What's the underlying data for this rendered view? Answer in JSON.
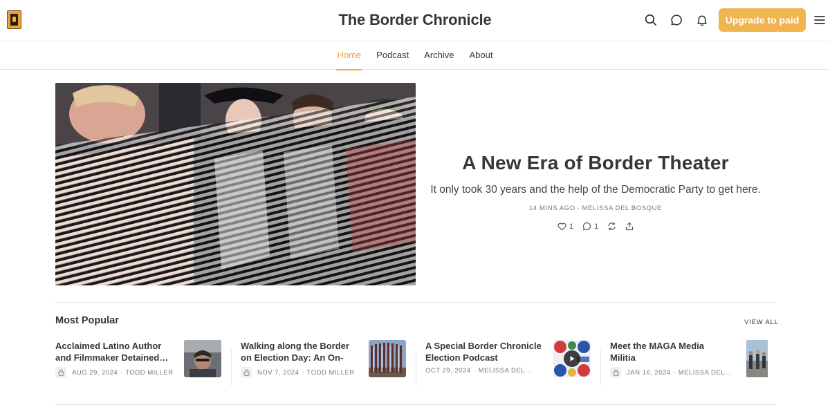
{
  "header": {
    "site_title": "The Border Chronicle",
    "upgrade_label": "Upgrade to paid",
    "icons": [
      "search-icon",
      "chat-icon",
      "bell-icon",
      "menu-icon"
    ],
    "accent_color": "#f0b54e"
  },
  "nav": {
    "items": [
      {
        "label": "Home",
        "active": true
      },
      {
        "label": "Podcast",
        "active": false
      },
      {
        "label": "Archive",
        "active": false
      },
      {
        "label": "About",
        "active": false
      }
    ]
  },
  "hero": {
    "title": "A New Era of Border Theater",
    "subtitle": "It only took 30 years and the help of the Democratic Party to get here.",
    "time": "14 MINS AGO",
    "separator": "∙",
    "author": "MELISSA DEL BOSQUE",
    "likes": "1",
    "comments": "1"
  },
  "most_popular": {
    "title": "Most Popular",
    "view_all": "VIEW ALL",
    "posts": [
      {
        "title": "Acclaimed Latino Author and Filmmaker Detained…",
        "date": "AUG 29, 2024",
        "author": "TODD MILLER",
        "locked": true
      },
      {
        "title": "Walking along the Border on Election Day: An On-the-…",
        "date": "NOV 7, 2024",
        "author": "TODD MILLER",
        "locked": true
      },
      {
        "title": "A Special Border Chronicle Election Podcast",
        "date": "OCT 29, 2024",
        "author": "MELISSA DEL…",
        "locked": false,
        "podcast": true
      },
      {
        "title": "Meet the MAGA Media Militia",
        "date": "JAN 16, 2024",
        "author": "MELISSA DEL…",
        "locked": true
      }
    ]
  }
}
